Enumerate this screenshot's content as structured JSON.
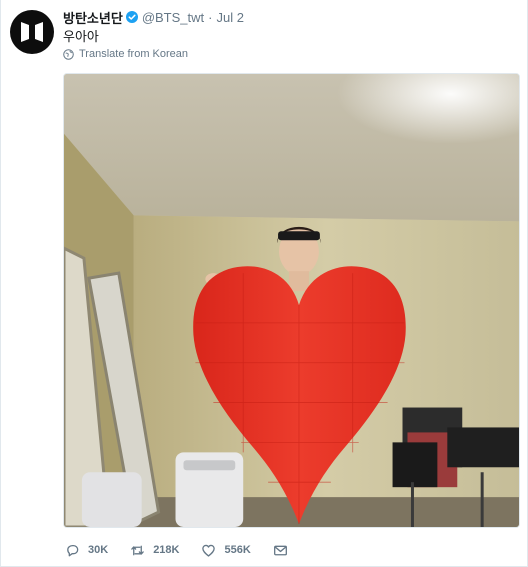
{
  "tweet": {
    "author_name": "방탄소년단",
    "handle": "@BTS_twt",
    "separator": "·",
    "date": "Jul 2",
    "text": "우아아",
    "translate_label": "Translate from Korean"
  },
  "actions": {
    "replies": "30K",
    "retweets": "218K",
    "likes": "556K"
  },
  "icons": {
    "avatar": "bts-logo-icon",
    "verified": "verified-badge-icon",
    "translate": "globe-icon",
    "reply": "reply-icon",
    "retweet": "retweet-icon",
    "like": "heart-icon",
    "message": "envelope-icon"
  },
  "colors": {
    "text": "#14171a",
    "muted": "#657786",
    "verified": "#1da1f2",
    "heart_prop": "#e8372a"
  }
}
